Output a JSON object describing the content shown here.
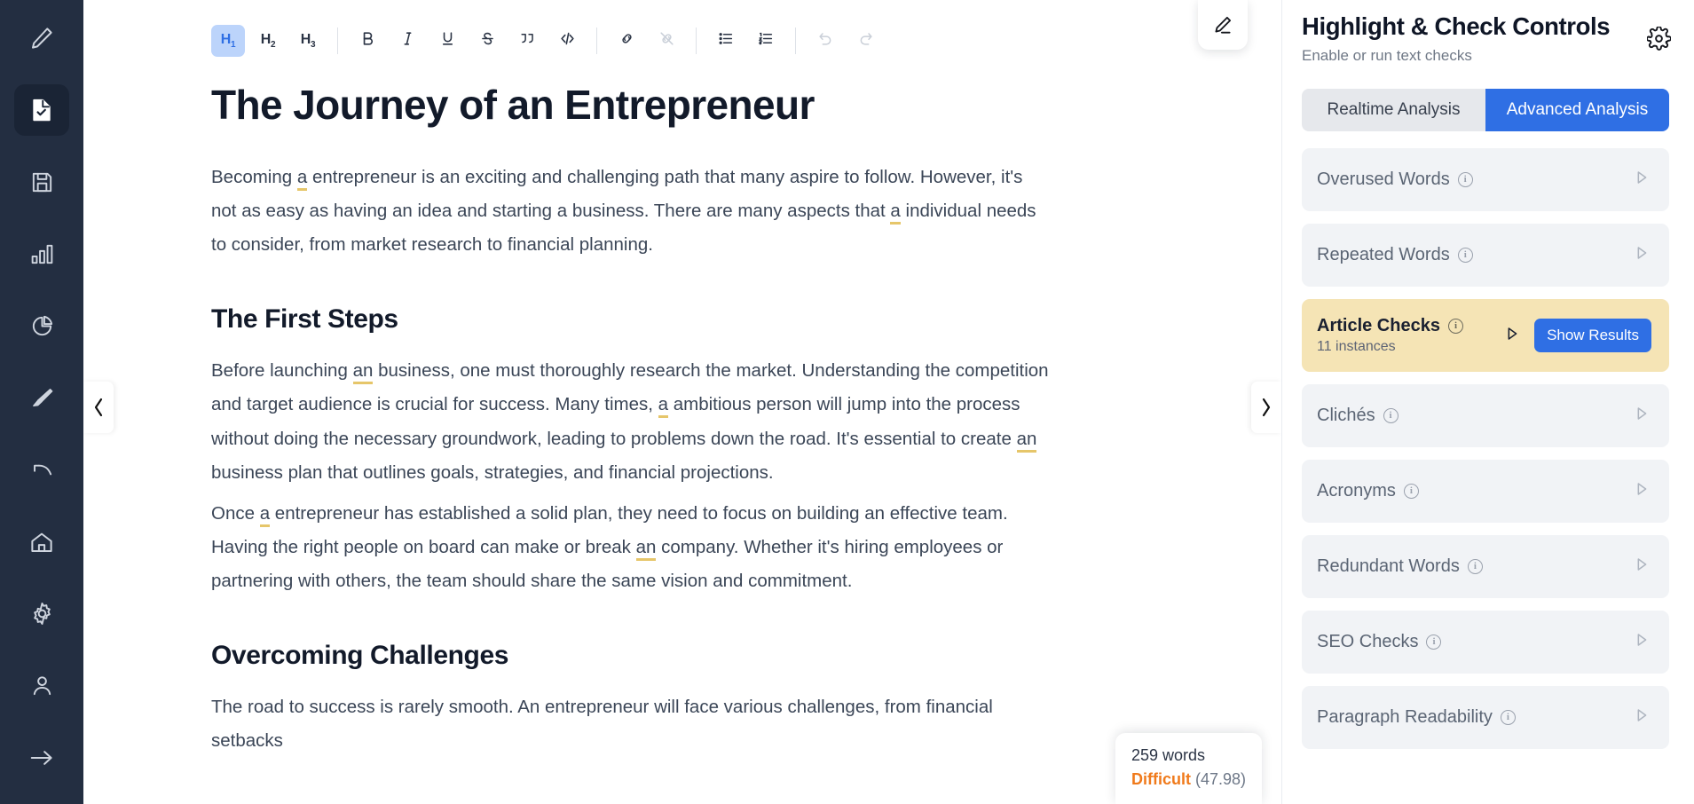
{
  "rail": {
    "items": [
      {
        "name": "pencil-icon",
        "label": "Write",
        "active": false
      },
      {
        "name": "document-check-icon",
        "label": "Document",
        "active": true
      },
      {
        "name": "save-icon",
        "label": "Save",
        "active": false
      },
      {
        "name": "bar-chart-icon",
        "label": "Statistics",
        "active": false
      },
      {
        "name": "pie-chart-icon",
        "label": "Reports",
        "active": false
      },
      {
        "name": "highlighter-icon",
        "label": "Highlight",
        "active": false
      },
      {
        "name": "corner-icon",
        "label": "Snippet",
        "active": false
      },
      {
        "name": "home-icon",
        "label": "Home",
        "active": false
      },
      {
        "name": "gear-icon",
        "label": "Settings",
        "active": false
      },
      {
        "name": "user-icon",
        "label": "Account",
        "active": false
      },
      {
        "name": "arrow-right-icon",
        "label": "Logout",
        "active": false
      }
    ]
  },
  "toolbar": {
    "groups": [
      [
        {
          "name": "heading-1-button",
          "label": "H",
          "sub": "1",
          "state": "active"
        },
        {
          "name": "heading-2-button",
          "label": "H",
          "sub": "2",
          "state": "normal"
        },
        {
          "name": "heading-3-button",
          "label": "H",
          "sub": "3",
          "state": "normal"
        }
      ],
      [
        {
          "name": "bold-button",
          "label": "B",
          "state": "normal"
        },
        {
          "name": "italic-button",
          "label": "I",
          "state": "normal"
        },
        {
          "name": "underline-button",
          "label": "U",
          "state": "normal"
        },
        {
          "name": "strikethrough-button",
          "label": "S",
          "state": "normal"
        },
        {
          "name": "blockquote-button",
          "label": "””",
          "state": "normal"
        },
        {
          "name": "code-block-button",
          "label": "</>",
          "state": "normal"
        }
      ],
      [
        {
          "name": "link-button",
          "label": "🔗",
          "state": "normal"
        },
        {
          "name": "unlink-button",
          "label": "🔗",
          "state": "disabled"
        }
      ],
      [
        {
          "name": "bullet-list-button",
          "label": "☰",
          "state": "normal"
        },
        {
          "name": "numbered-list-button",
          "label": "☰",
          "state": "normal"
        }
      ],
      [
        {
          "name": "undo-button",
          "label": "↶",
          "state": "disabled"
        },
        {
          "name": "redo-button",
          "label": "↷",
          "state": "disabled"
        }
      ]
    ]
  },
  "document": {
    "title": "The Journey of an Entrepreneur",
    "blocks": [
      {
        "type": "paragraph",
        "runs": [
          {
            "t": "Becoming ",
            "h": false
          },
          {
            "t": "a",
            "h": true
          },
          {
            "t": " entrepreneur is an exciting and challenging path that many aspire to follow. However, it's not as easy as having an idea and starting a business. There are many aspects that ",
            "h": false
          },
          {
            "t": "a",
            "h": true
          },
          {
            "t": " individual needs to consider, from market research to financial planning.",
            "h": false
          }
        ]
      },
      {
        "type": "heading2",
        "text": "The First Steps"
      },
      {
        "type": "paragraph",
        "runs": [
          {
            "t": "Before launching ",
            "h": false
          },
          {
            "t": "an",
            "h": true
          },
          {
            "t": " business, one must thoroughly research the market. Understanding the competition and target audience is crucial for success. Many times, ",
            "h": false
          },
          {
            "t": "a",
            "h": true
          },
          {
            "t": " ambitious person will jump into the process without doing the necessary groundwork, leading to problems down the road. It's essential to create ",
            "h": false
          },
          {
            "t": "an",
            "h": true
          },
          {
            "t": " business plan that outlines goals, strategies, and financial projections.",
            "h": false
          }
        ]
      },
      {
        "type": "paragraph",
        "runs": [
          {
            "t": "Once ",
            "h": false
          },
          {
            "t": "a",
            "h": true
          },
          {
            "t": " entrepreneur has established a solid plan, they need to focus on building an effective team. Having the right people on board can make or break ",
            "h": false
          },
          {
            "t": "an",
            "h": true
          },
          {
            "t": " company. Whether it's hiring employees or partnering with others, the team should share the same vision and commitment.",
            "h": false
          }
        ]
      },
      {
        "type": "heading2",
        "text": "Overcoming Challenges"
      },
      {
        "type": "paragraph",
        "runs": [
          {
            "t": "The road to success is rarely smooth. An entrepreneur will face various challenges, from financial setbacks",
            "h": false
          }
        ]
      }
    ]
  },
  "collapse": {
    "left_label": "‹",
    "right_label": "›"
  },
  "wordcount": {
    "words": "259 words",
    "difficulty_label": "Difficult",
    "difficulty_score": "(47.98)"
  },
  "panel": {
    "title": "Highlight & Check Controls",
    "subtitle": "Enable or run text checks",
    "tabs": [
      {
        "label": "Realtime Analysis",
        "selected": false
      },
      {
        "label": "Advanced Analysis",
        "selected": true
      }
    ],
    "checks": [
      {
        "label": "Overused Words",
        "sub": "",
        "highlight": false,
        "has_button": false
      },
      {
        "label": "Repeated Words",
        "sub": "",
        "highlight": false,
        "has_button": false
      },
      {
        "label": "Article Checks",
        "sub": "11 instances",
        "highlight": true,
        "has_button": true,
        "button_label": "Show Results"
      },
      {
        "label": "Clichés",
        "sub": "",
        "highlight": false,
        "has_button": false
      },
      {
        "label": "Acronyms",
        "sub": "",
        "highlight": false,
        "has_button": false
      },
      {
        "label": "Redundant Words",
        "sub": "",
        "highlight": false,
        "has_button": false
      },
      {
        "label": "SEO Checks",
        "sub": "",
        "highlight": false,
        "has_button": false
      },
      {
        "label": "Paragraph Readability",
        "sub": "",
        "highlight": false,
        "has_button": false
      }
    ]
  },
  "colors": {
    "accent": "#2f6fe4",
    "rail_bg": "#232e41",
    "highlight_card": "#f5e4b5",
    "underline": "#e6c66a",
    "difficulty": "#f07a1b"
  }
}
